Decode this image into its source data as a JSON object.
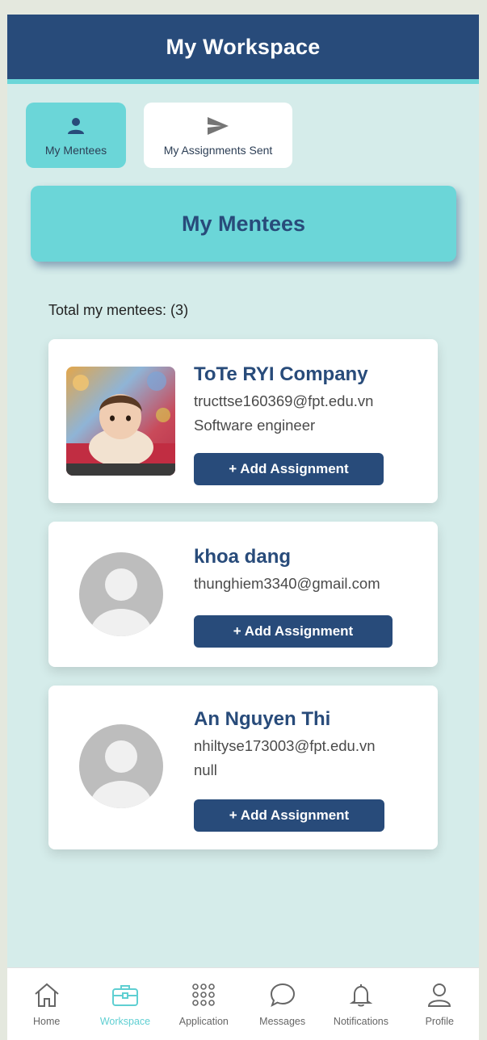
{
  "header": {
    "title": "My Workspace"
  },
  "tabs": [
    {
      "label": "My Mentees",
      "icon": "person-icon",
      "active": true
    },
    {
      "label": "My Assignments Sent",
      "icon": "send-icon",
      "active": false
    }
  ],
  "banner": {
    "title": "My Mentees"
  },
  "summary": {
    "total_text": "Total my mentees: (3)"
  },
  "mentees": [
    {
      "name": "ToTe RYI Company",
      "email": "tructtse160369@fpt.edu.vn",
      "role": "Software engineer",
      "avatar": "photo",
      "button": "+ Add Assignment"
    },
    {
      "name": "khoa dang",
      "email": "thunghiem3340@gmail.com",
      "avatar": "default-avatar-icon",
      "button": "+ Add Assignment"
    },
    {
      "name": "An Nguyen Thi",
      "email": "nhiltyse173003@fpt.edu.vn",
      "role": "null",
      "avatar": "default-avatar-icon",
      "button": "+ Add Assignment"
    }
  ],
  "nav": [
    {
      "label": "Home",
      "icon": "home-icon"
    },
    {
      "label": "Workspace",
      "icon": "briefcase-icon",
      "active": true
    },
    {
      "label": "Application",
      "icon": "grid-icon"
    },
    {
      "label": "Messages",
      "icon": "chat-icon"
    },
    {
      "label": "Notifications",
      "icon": "bell-icon"
    },
    {
      "label": "Profile",
      "icon": "user-icon"
    }
  ],
  "colors": {
    "primary": "#284b7a",
    "accent": "#6bd6d8",
    "background": "#d5ecea",
    "active_nav": "#5fcfd2"
  }
}
